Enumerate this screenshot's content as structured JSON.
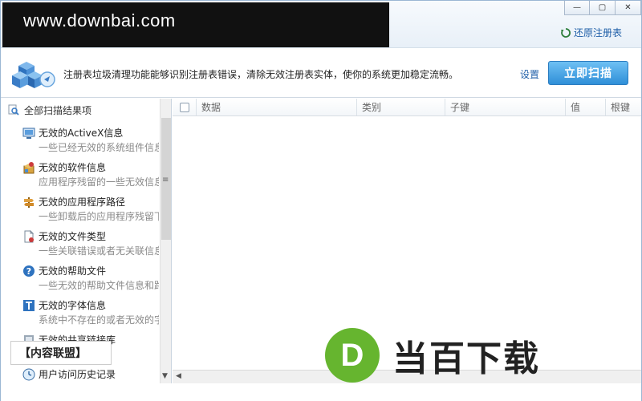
{
  "window": {
    "brand_banner": "www.downbai.com",
    "controls": {
      "minimize": "—",
      "maximize": "▢",
      "close": "✕"
    },
    "restore_link": "还原注册表"
  },
  "infobar": {
    "description": "注册表垃圾清理功能能够识别注册表错误，清除无效注册表实体，使你的系统更加稳定流畅。",
    "settings_label": "设置",
    "scan_button": "立即扫描"
  },
  "left_panel": {
    "header": "全部扫描结果项",
    "categories": [
      {
        "title": "无效的ActiveX信息",
        "desc": "一些已经无效的系统组件信息",
        "icon": "monitor-icon"
      },
      {
        "title": "无效的软件信息",
        "desc": "应用程序残留的一些无效信息",
        "icon": "software-box-icon"
      },
      {
        "title": "无效的应用程序路径",
        "desc": "一些卸载后的应用程序残留下",
        "icon": "signpost-icon"
      },
      {
        "title": "无效的文件类型",
        "desc": "一些关联错误或者无关联信息",
        "icon": "document-icon"
      },
      {
        "title": "无效的帮助文件",
        "desc": "一些无效的帮助文件信息和路",
        "icon": "help-icon"
      },
      {
        "title": "无效的字体信息",
        "desc": "系统中不存在的或者无效的字",
        "icon": "font-icon"
      },
      {
        "title": "无效的共享链接库",
        "desc": "一些丢失的共享",
        "icon": "dll-icon"
      },
      {
        "title": "用户访问历史记录",
        "desc": "",
        "icon": "history-icon"
      }
    ]
  },
  "table": {
    "columns": [
      "数据",
      "类别",
      "子键",
      "值",
      "根键"
    ]
  },
  "watermarks": {
    "left_label": "【内容联盟】",
    "logo_letter": "D",
    "logo_text": "当百下载"
  }
}
